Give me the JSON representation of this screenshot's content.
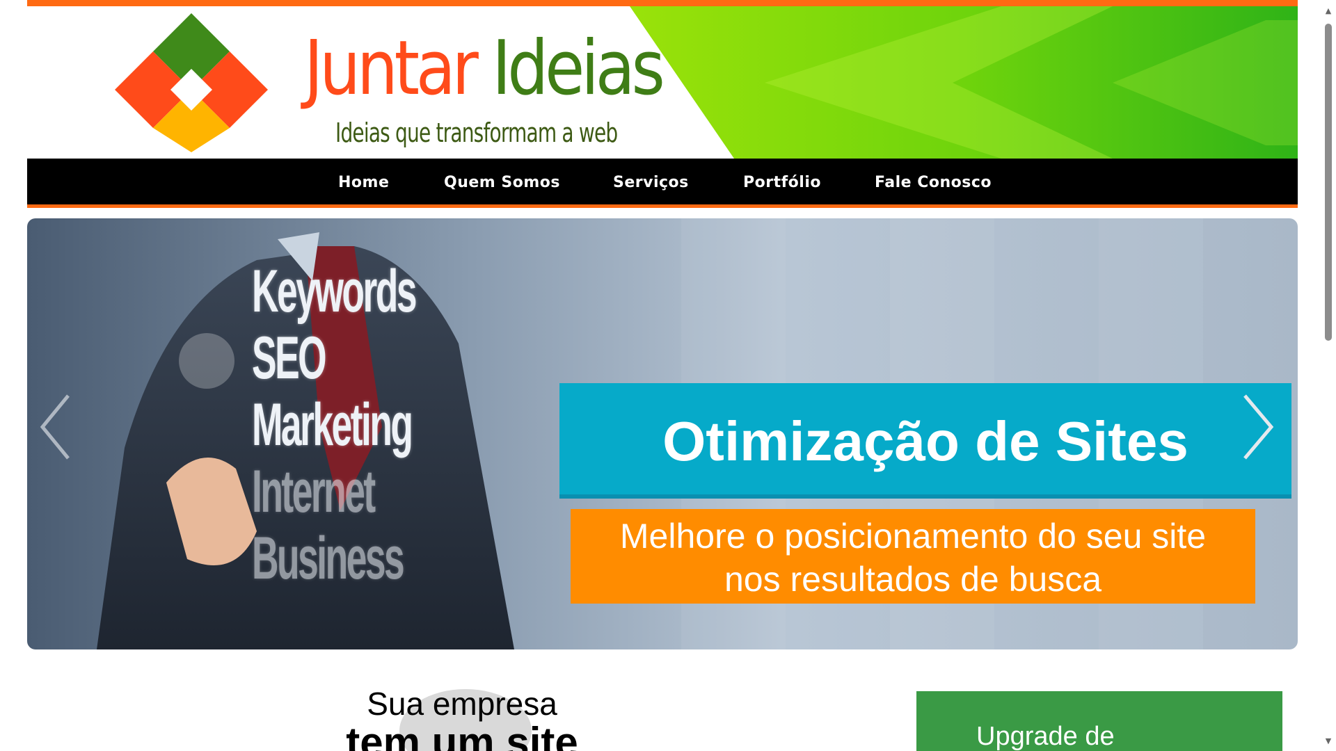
{
  "header": {
    "logo_word1": "Juntar",
    "logo_word2": "Ideias",
    "tagline": "Ideias que transformam a web"
  },
  "nav": {
    "items": [
      "Home",
      "Quem Somos",
      "Serviços",
      "Portfólio",
      "Fale Conosco"
    ]
  },
  "slider": {
    "keywords": [
      "Keywords",
      "SEO",
      "Marketing",
      "Internet",
      "Business"
    ],
    "caption_title": "Otimização de Sites",
    "caption_sub_line1": "Melhore o posicionamento do seu site",
    "caption_sub_line2": "nos resultados de busca"
  },
  "promo": {
    "line1": "Sua empresa",
    "line2": "tem um site"
  },
  "upgrade": {
    "label": "Upgrade de"
  },
  "colors": {
    "accent_orange": "#ff6a13",
    "logo_orange": "#ff4b1a",
    "logo_green": "#3f7d16",
    "caption_blue": "#06aac9",
    "caption_orange": "#ff8c00",
    "upgrade_green": "#3a9a45",
    "nav_bg": "#000000"
  },
  "icons": {
    "prev": "chevron-left-icon",
    "next": "chevron-right-icon",
    "logo": "puzzle-logo-icon"
  }
}
